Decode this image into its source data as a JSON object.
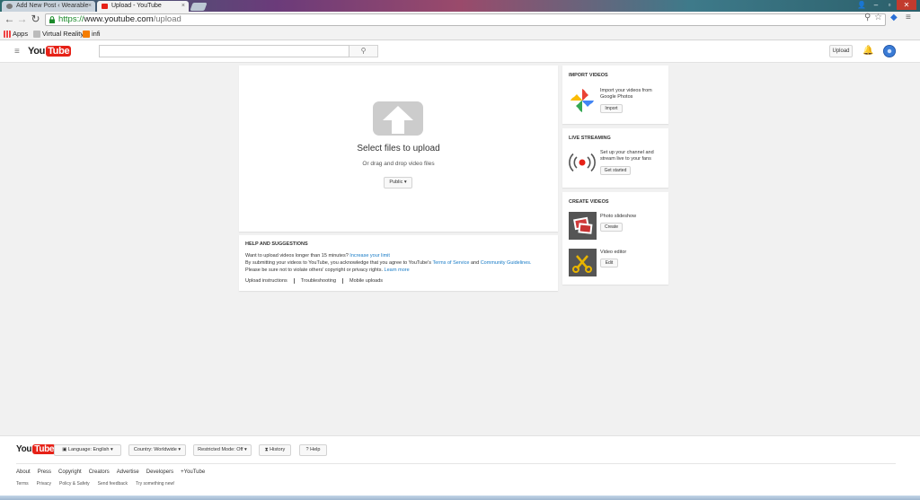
{
  "browser": {
    "tabs": [
      {
        "title": "Add New Post ‹ Wearable",
        "active": false
      },
      {
        "title": "Upload - YouTube",
        "active": true
      }
    ],
    "url_scheme": "https://",
    "url_host": "www.youtube.com",
    "url_path": "/upload",
    "bookmarks": [
      "Apps",
      "Virtual Reality",
      "infi"
    ]
  },
  "masthead": {
    "logo_you": "You",
    "logo_tube": "Tube",
    "upload_label": "Upload"
  },
  "upload": {
    "title": "Select files to upload",
    "subtitle": "Or drag and drop video files",
    "privacy": "Public"
  },
  "help": {
    "title": "HELP AND SUGGESTIONS",
    "line1_prefix": "Want to upload videos longer than 15 minutes?",
    "line1_link": "Increase your limit",
    "line2_prefix": "By submitting your videos to YouTube, you acknowledge that you agree to YouTube's",
    "line2_link1": "Terms of Service",
    "line2_and": "and",
    "line2_link2": "Community Guidelines.",
    "line3_prefix": "Please be sure not to violate others' copyright or privacy rights.",
    "line3_link": "Learn more",
    "links": [
      "Upload instructions",
      "Troubleshooting",
      "Mobile uploads"
    ]
  },
  "import": {
    "title": "IMPORT VIDEOS",
    "text": "Import your videos from Google Photos",
    "button": "Import"
  },
  "live": {
    "title": "LIVE STREAMING",
    "text": "Set up your channel and stream live to your fans",
    "button": "Get started"
  },
  "create": {
    "title": "CREATE VIDEOS",
    "items": [
      {
        "label": "Photo slideshow",
        "button": "Create"
      },
      {
        "label": "Video editor",
        "button": "Edit"
      }
    ]
  },
  "footer": {
    "language": "Language: English",
    "country": "Country: Worldwide",
    "restricted": "Restricted Mode: Off",
    "history": "History",
    "help": "Help",
    "links": [
      "About",
      "Press",
      "Copyright",
      "Creators",
      "Advertise",
      "Developers",
      "+YouTube"
    ],
    "links2": [
      "Terms",
      "Privacy",
      "Policy & Safety",
      "Send feedback",
      "Try something new!"
    ]
  },
  "colors": {
    "brand_red": "#e62117",
    "link_blue": "#167ac6",
    "https_green": "#1b8a2a"
  }
}
